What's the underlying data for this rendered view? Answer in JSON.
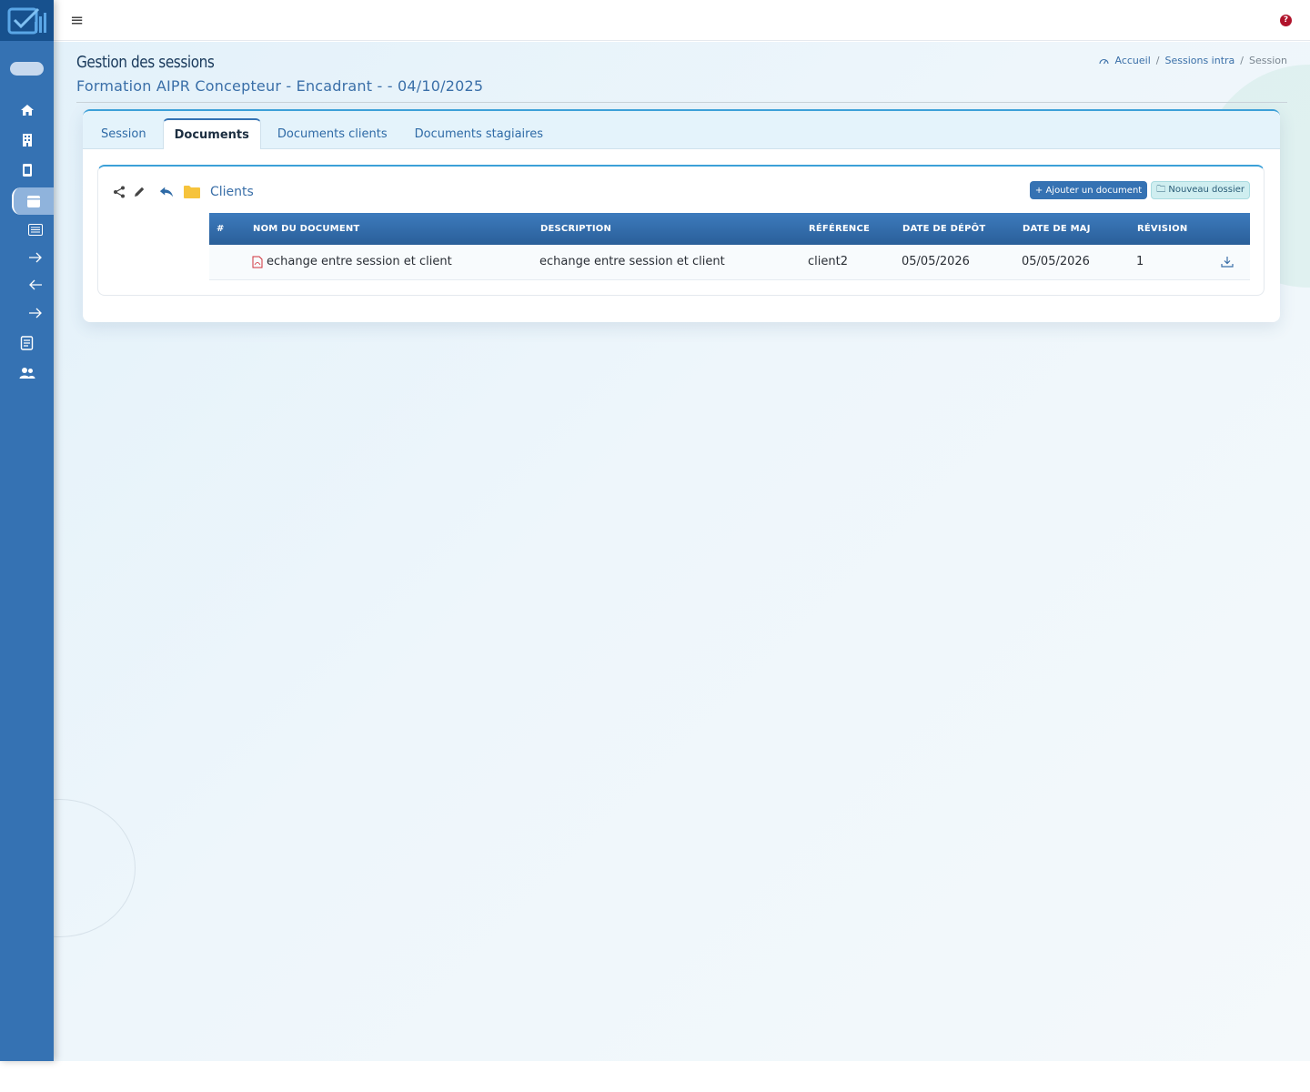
{
  "topbar": {
    "menu_icon": "hamburger-icon",
    "help_label": "?"
  },
  "sidebar": {
    "items": [
      {
        "icon": "home-icon"
      },
      {
        "icon": "building-icon"
      },
      {
        "icon": "book-icon"
      },
      {
        "icon": "calendar-icon",
        "active": true
      },
      {
        "icon": "list-icon"
      },
      {
        "icon": "arrow-right-icon"
      },
      {
        "icon": "arrow-left-icon"
      },
      {
        "icon": "arrow-right-icon"
      },
      {
        "icon": "notebook-icon"
      },
      {
        "icon": "users-icon"
      }
    ]
  },
  "page": {
    "title": "Gestion des sessions",
    "subtitle": "Formation AIPR Concepteur - Encadrant - - 04/10/2025"
  },
  "breadcrumb": {
    "home": "Accueil",
    "sep1": "/",
    "level1": "Sessions intra",
    "sep2": "/",
    "current": "Session"
  },
  "tabs": {
    "session": "Session",
    "documents": "Documents",
    "documents_clients": "Documents clients",
    "documents_stagiaires": "Documents stagiaires"
  },
  "folder": {
    "name": "Clients"
  },
  "actions": {
    "add_document": "+ Ajouter un document",
    "new_folder": "Nouveau dossier"
  },
  "table": {
    "headers": {
      "num": "#",
      "name": "Nom du document",
      "description": "Description",
      "reference": "Référence",
      "date_depot": "Date de dépôt",
      "date_maj": "Date de MAJ",
      "revision": "Révision"
    },
    "rows": [
      {
        "num": "",
        "name": "echange entre session et client",
        "description": "echange entre session et client",
        "reference": "client2",
        "date_depot": "05/05/2026",
        "date_maj": "05/05/2026",
        "revision": "1"
      }
    ]
  }
}
